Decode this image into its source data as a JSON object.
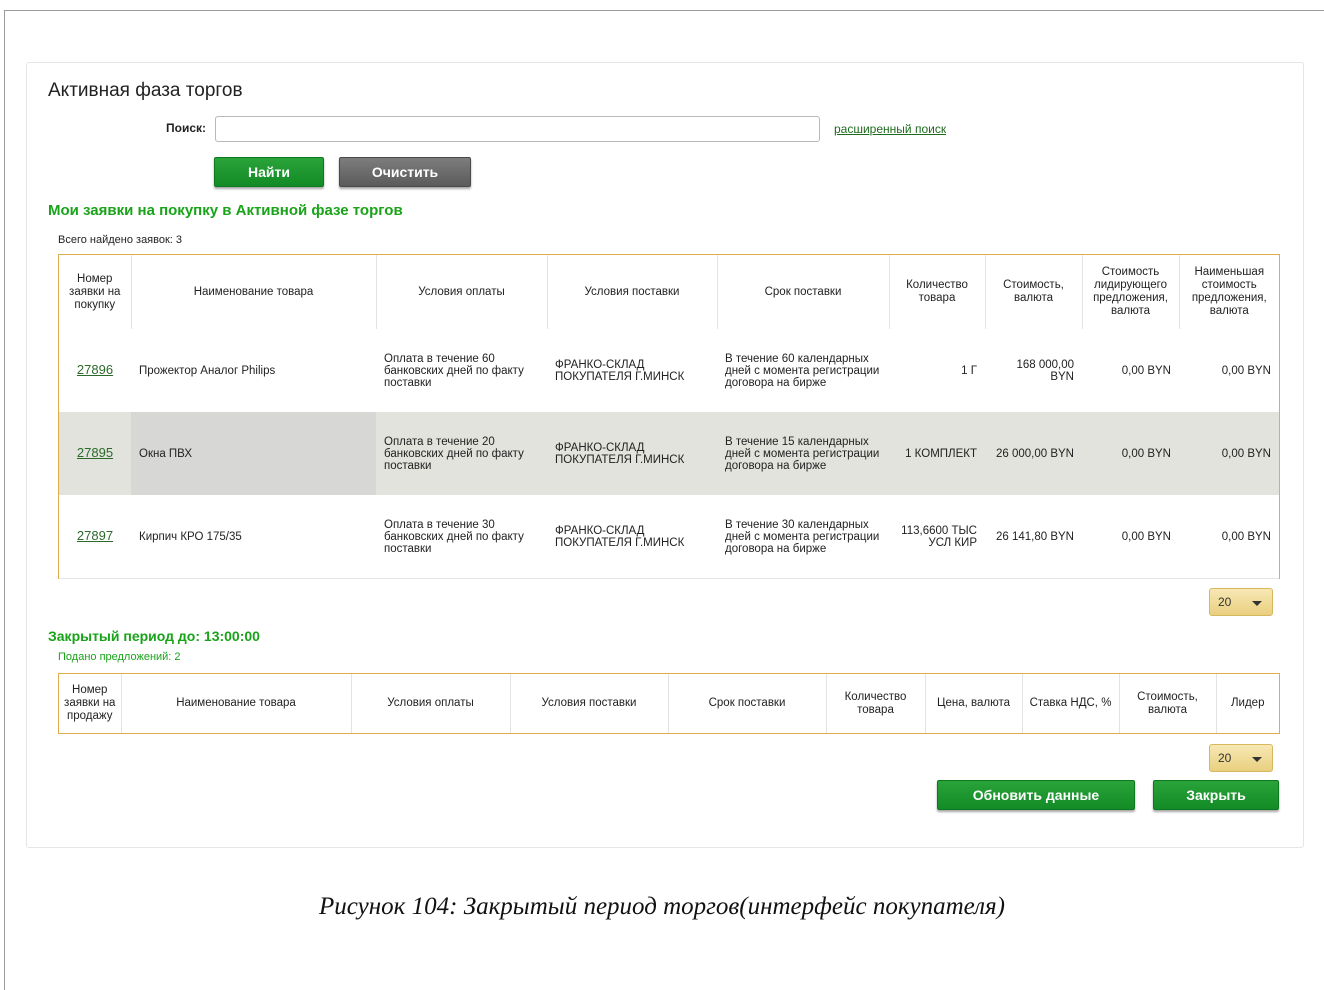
{
  "page": {
    "title": "Активная фаза торгов"
  },
  "search": {
    "label": "Поиск:",
    "value": "",
    "placeholder": "",
    "advanced_link": "расширенный поиск",
    "find_button": "Найти",
    "clear_button": "Очистить"
  },
  "my_requests": {
    "heading": "Мои заявки на покупку в Активной фазе торгов",
    "total_found": "Всего найдено заявок: 3",
    "columns": [
      "Номер заявки на покупку",
      "Наименование товара",
      "Условия оплаты",
      "Условия поставки",
      "Срок поставки",
      "Количество товара",
      "Стоимость, валюта",
      "Стоимость лидирующего предложения, валюта",
      "Наименьшая стоимость предложения, валюта"
    ],
    "rows": [
      {
        "number": "27896",
        "name": "Прожектор Аналог Philips",
        "payment": "Оплата в течение 60 банковских дней по факту поставки",
        "delivery": "ФРАНКО-СКЛАД ПОКУПАТЕЛЯ Г.МИНСК",
        "term": "В течение 60 календарных дней с момента регистрации договора на бирже",
        "quantity": "1 Г",
        "cost": "168 000,00 BYN",
        "leader_cost": "0,00 BYN",
        "min_cost": "0,00 BYN"
      },
      {
        "number": "27895",
        "name": "Окна ПВХ",
        "payment": "Оплата в течение 20 банковских дней по факту поставки",
        "delivery": "ФРАНКО-СКЛАД ПОКУПАТЕЛЯ Г.МИНСК",
        "term": "В течение 15 календарных дней с момента регистрации договора на бирже",
        "quantity": "1 КОМПЛЕКТ",
        "cost": "26 000,00 BYN",
        "leader_cost": "0,00 BYN",
        "min_cost": "0,00 BYN"
      },
      {
        "number": "27897",
        "name": "Кирпич КРО 175/35",
        "payment": "Оплата в течение 30 банковских дней по факту поставки",
        "delivery": "ФРАНКО-СКЛАД ПОКУПАТЕЛЯ Г.МИНСК",
        "term": "В течение 30 календарных дней с момента регистрации договора на бирже",
        "quantity": "113,6600 ТЫС УСЛ КИР",
        "cost": "26 141,80 BYN",
        "leader_cost": "0,00 BYN",
        "min_cost": "0,00 BYN"
      }
    ],
    "page_size": "20"
  },
  "closed_period": {
    "heading": "Закрытый период до: 13:00:00",
    "offers_submitted": "Подано предложений: 2",
    "columns": [
      "Номер заявки на продажу",
      "Наименование товара",
      "Условия оплаты",
      "Условия поставки",
      "Срок поставки",
      "Количество товара",
      "Цена, валюта",
      "Ставка НДС, %",
      "Стоимость, валюта",
      "Лидер"
    ],
    "page_size": "20"
  },
  "actions": {
    "refresh_button": "Обновить данные",
    "close_button": "Закрыть"
  },
  "caption": "Рисунок 104: Закрытый период  торгов(интерфейс покупателя)",
  "colors": {
    "accent_green": "#19a319",
    "button_green": "#138b26",
    "table_border": "#e0ad4c",
    "row_alt": "#e3e3dd"
  }
}
